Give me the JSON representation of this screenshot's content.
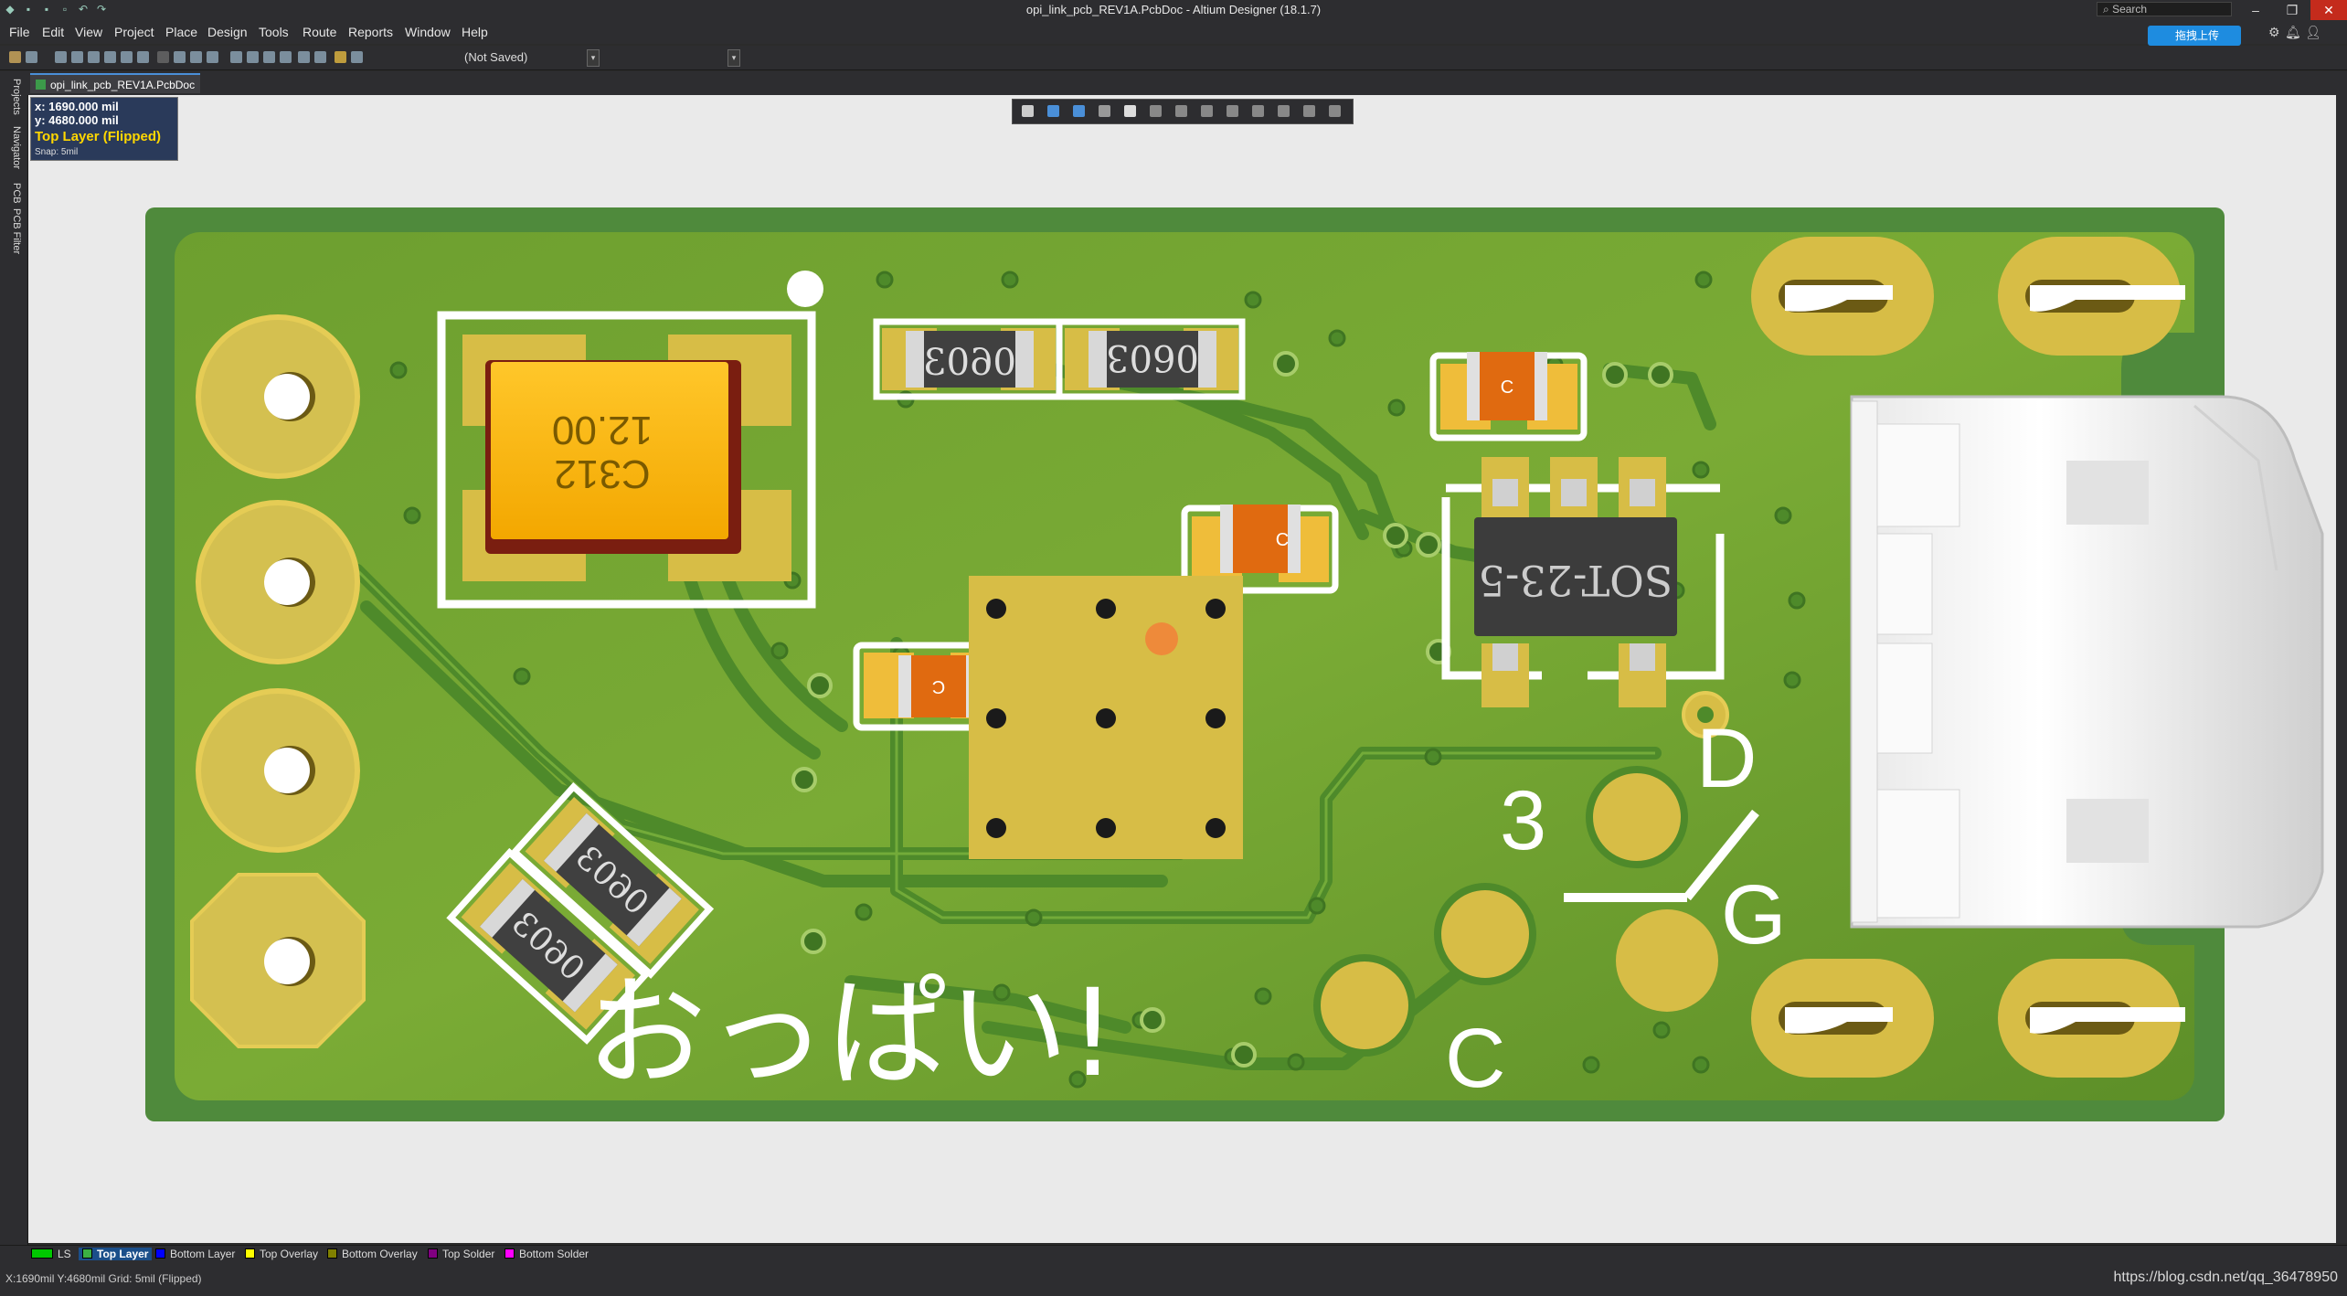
{
  "window": {
    "title": "opi_link_pcb_REV1A.PcbDoc - Altium Designer (18.1.7)",
    "search_placeholder": "Search",
    "upload_button": "拖拽上传",
    "minimize_icon": "minimize-icon",
    "maximize_icon": "maximize-icon",
    "close_icon": "close-icon"
  },
  "menu": [
    "File",
    "Edit",
    "View",
    "Project",
    "Place",
    "Design",
    "Tools",
    "Route",
    "Reports",
    "Window",
    "Help"
  ],
  "toolbar": {
    "save_state": "(Not Saved)"
  },
  "left_panels": [
    "Projects",
    "Navigator",
    "PCB",
    "PCB Filter"
  ],
  "document_tab": "opi_link_pcb_REV1A.PcbDoc",
  "hud": {
    "x": "x:  1690.000  mil",
    "y": "y:  4680.000  mil",
    "layer": "Top Layer (Flipped)",
    "snap": "Snap: 5mil"
  },
  "pcb": {
    "cap_tantalum_value": "12.00",
    "cap_tantalum_ref": "C312",
    "resistor_pkg": "0603",
    "small_cap_label": "C",
    "sot_label": "SOT-23-5",
    "silk_text": "おっぱい!",
    "pin_labels": {
      "three": "3",
      "d": "D",
      "g": "G",
      "c": "C"
    }
  },
  "layers": [
    {
      "name": "LS",
      "color": "#00c800",
      "active": false
    },
    {
      "name": "Top Layer",
      "color": "#3cb043",
      "active": true
    },
    {
      "name": "Bottom Layer",
      "color": "#0000ff",
      "active": false
    },
    {
      "name": "Top Overlay",
      "color": "#ffff00",
      "active": false
    },
    {
      "name": "Bottom Overlay",
      "color": "#808000",
      "active": false
    },
    {
      "name": "Top Solder",
      "color": "#800080",
      "active": false
    },
    {
      "name": "Bottom Solder",
      "color": "#ff00ff",
      "active": false
    }
  ],
  "status": {
    "left": "X:1690mil Y:4680mil   Grid: 5mil   (Flipped)",
    "watermark": "https://blog.csdn.net/qq_36478950"
  }
}
